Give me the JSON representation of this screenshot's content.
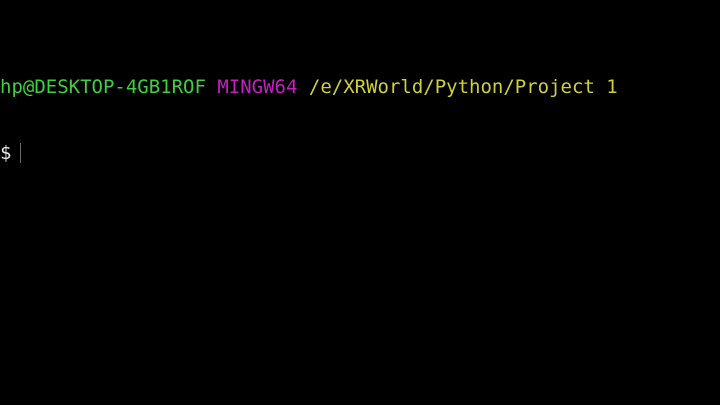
{
  "prompt": {
    "user_host": "hp@DESKTOP-4GB1ROF",
    "system": "MINGW64",
    "path": "/e/XRWorld/Python/Project 1",
    "symbol": "$"
  },
  "colors": {
    "background": "#000000",
    "user_host": "#3dd13d",
    "system": "#c31fc3",
    "path": "#d0d03a",
    "text": "#e6e6e6"
  }
}
